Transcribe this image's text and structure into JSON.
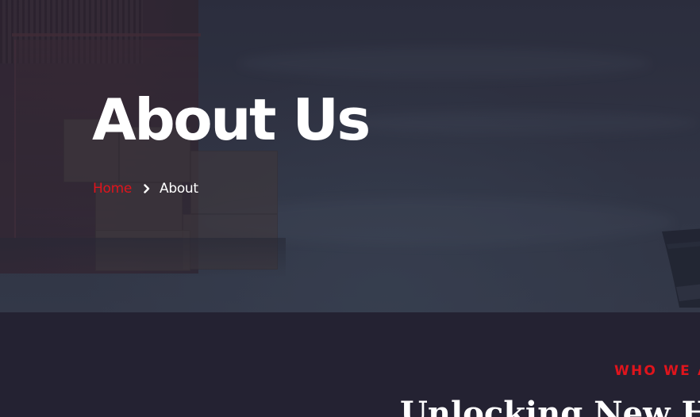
{
  "hero": {
    "title": "About Us",
    "breadcrumb": {
      "home_label": "Home",
      "current_label": "About",
      "separator_icon": "chevron-right-icon"
    }
  },
  "about": {
    "eyebrow": "WHO WE ARE",
    "heading": "Unlocking New Horizons"
  },
  "colors": {
    "accent": "#e0141c",
    "background": "#242232",
    "text": "#ffffff"
  }
}
